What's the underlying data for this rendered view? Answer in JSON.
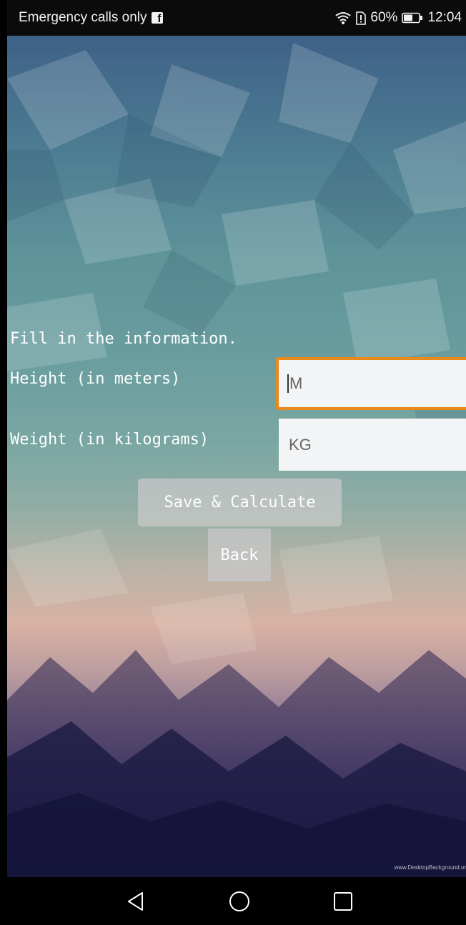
{
  "status_bar": {
    "carrier": "Emergency calls only",
    "battery_percent": "60%",
    "time": "12:04",
    "icons": [
      "facebook-icon",
      "wifi-icon",
      "sim-icon",
      "battery-icon"
    ]
  },
  "form": {
    "heading": "Fill in the information.",
    "height_label": "Height (in meters)",
    "height_placeholder": "M",
    "weight_label": "Weight (in kilograms)",
    "weight_placeholder": "KG"
  },
  "buttons": {
    "save_label": "Save & Calculate",
    "back_label": "Back"
  },
  "watermark": "www.DesktopBackground.or",
  "nav_bar": {
    "icons": [
      "nav-back-icon",
      "nav-home-icon",
      "nav-recents-icon"
    ]
  },
  "colors": {
    "focus_border": "#e88a1b",
    "input_bg": "#f3f4f6",
    "button_bg": "#c8c8c8"
  }
}
